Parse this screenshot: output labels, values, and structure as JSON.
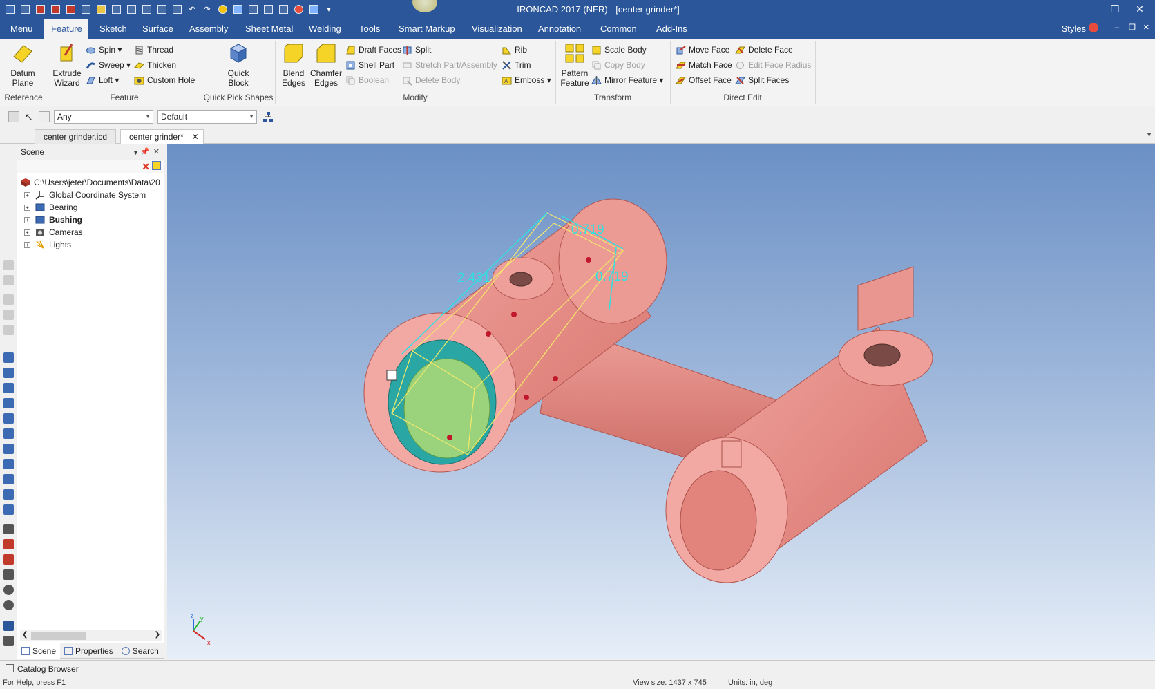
{
  "app": {
    "title": "IRONCAD 2017 (NFR) - [center grinder*]"
  },
  "tabs": [
    "Menu",
    "Feature",
    "Sketch",
    "Surface",
    "Assembly",
    "Sheet Metal",
    "Welding",
    "Tools",
    "Smart Markup",
    "Visualization",
    "Annotation",
    "Common",
    "Add-Ins"
  ],
  "active_tab": "Feature",
  "styles_label": "Styles",
  "ribbon": {
    "reference": {
      "label": "Reference",
      "datum_plane": "Datum\nPlane"
    },
    "feature": {
      "label": "Feature",
      "extrude_wizard": "Extrude\nWizard",
      "spin": "Spin",
      "sweep": "Sweep",
      "loft": "Loft",
      "thread": "Thread",
      "thicken": "Thicken",
      "custom_hole": "Custom Hole"
    },
    "quick_pick": {
      "label": "Quick Pick Shapes",
      "quick_block": "Quick\nBlock"
    },
    "modify": {
      "label": "Modify",
      "blend_edges": "Blend\nEdges",
      "chamfer_edges": "Chamfer\nEdges",
      "draft_faces": "Draft Faces",
      "shell_part": "Shell Part",
      "boolean": "Boolean",
      "split": "Split",
      "stretch": "Stretch Part/Assembly",
      "delete_body": "Delete Body",
      "rib": "Rib",
      "trim": "Trim",
      "emboss": "Emboss"
    },
    "transform": {
      "label": "Transform",
      "pattern_feature": "Pattern\nFeature",
      "scale_body": "Scale Body",
      "copy_body": "Copy Body",
      "mirror_feature": "Mirror Feature"
    },
    "direct_edit": {
      "label": "Direct Edit",
      "move_face": "Move Face",
      "match_face": "Match Face",
      "offset_face": "Offset Face",
      "delete_face": "Delete Face",
      "edit_face_radius": "Edit Face Radius",
      "split_faces": "Split Faces"
    }
  },
  "toolbar2": {
    "filter_value": "Any",
    "style_value": "Default"
  },
  "doc_tabs": [
    "center grinder.icd",
    "center grinder*"
  ],
  "scene": {
    "title": "Scene",
    "root": "C:\\Users\\jeter\\Documents\\Data\\20",
    "items": [
      {
        "label": "Global Coordinate System",
        "bold": false
      },
      {
        "label": "Bearing",
        "bold": false
      },
      {
        "label": "Bushing",
        "bold": true
      },
      {
        "label": "Cameras",
        "bold": false
      },
      {
        "label": "Lights",
        "bold": false
      }
    ],
    "panel_tabs": [
      "Scene",
      "Properties",
      "Search"
    ]
  },
  "viewport": {
    "dimensions": [
      "0.719",
      "2.431",
      "0.719"
    ],
    "axis_labels": [
      "z",
      "y",
      "x"
    ],
    "part_color": "#e8928c",
    "highlight_color": "#2aa7a5"
  },
  "catalog_label": "Catalog Browser",
  "status": {
    "help": "For Help, press F1",
    "view_size": "View size: 1437 x 745",
    "units": "Units: in, deg"
  }
}
